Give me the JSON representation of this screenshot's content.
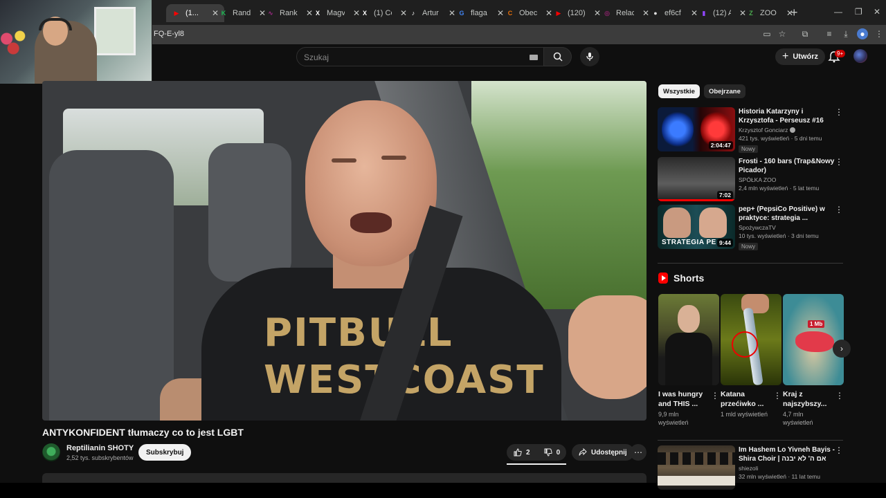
{
  "browser": {
    "tabs": [
      {
        "label": "(1...",
        "favicon": "youtube-icon",
        "color": "#ff0000",
        "active": true
      },
      {
        "label": "Rand",
        "favicon": "k-icon",
        "color": "#1db954"
      },
      {
        "label": "Ranki",
        "favicon": "rank-icon",
        "color": "#a52a8a"
      },
      {
        "label": "Magv",
        "favicon": "x-icon",
        "color": "#ffffff"
      },
      {
        "label": "(1) Co",
        "favicon": "x-icon",
        "color": "#ffffff"
      },
      {
        "label": "Artur",
        "favicon": "tiktok-icon",
        "color": "#ffffff"
      },
      {
        "label": "flaga",
        "favicon": "google-icon",
        "color": "#4285f4"
      },
      {
        "label": "Obec",
        "favicon": "c-icon",
        "color": "#e8700a"
      },
      {
        "label": "(120)",
        "favicon": "youtube-icon",
        "color": "#ff0000"
      },
      {
        "label": "Relac",
        "favicon": "instagram-icon",
        "color": "#d6249f"
      },
      {
        "label": "ef6cf",
        "favicon": "github-icon",
        "color": "#dddddd"
      },
      {
        "label": "(12) A",
        "favicon": "twitch-icon",
        "color": "#9146ff"
      },
      {
        "label": "ZOO",
        "favicon": "zoo-icon",
        "color": "#4caf50"
      }
    ],
    "url": "FQ-E-yl8",
    "new_tab_symbol": "+"
  },
  "header": {
    "search_placeholder": "Szukaj",
    "create_label": "Utwórz",
    "notif_count": "9+"
  },
  "video": {
    "shirt_line1": "PITBULL",
    "shirt_line2": "WESTCOAST",
    "title": "ANTYKONFIDENT tłumaczy co to jest LGBT",
    "channel": "Reptilianin SHOTY",
    "subscribers": "2,52 tys. subskrybentów",
    "subscribe_label": "Subskrybuj",
    "likes": "2",
    "dislikes": "0",
    "share_label": "Udostępnij"
  },
  "sidebar": {
    "chips": [
      "Wszystkie",
      "Obejrzane"
    ],
    "recommendations": [
      {
        "title": "Historia Katarzyny i Krzysztofa - Perseusz #16",
        "channel": "Krzysztof Gonciarz",
        "verified": true,
        "views": "421 tys. wyświetleń · 5 dni temu",
        "duration": "2:04:47",
        "badge": "Nowy"
      },
      {
        "title": "Frosti - 160 bars (Trap&Nowy Picador)",
        "channel": "SPÓŁKA ZOO",
        "verified": false,
        "views": "2,4 mln wyświetleń · 5 lat temu",
        "duration": "7:02",
        "badge": ""
      },
      {
        "title": "pep+ (PepsiCo Positive) w praktyce: strategia ...",
        "channel": "SpożywczaTV",
        "verified": false,
        "views": "10 tys. wyświetleń · 3 dni temu",
        "duration": "9:44",
        "badge": "Nowy",
        "thumb_text": "STRATEGIA PE"
      }
    ],
    "shorts_title": "Shorts",
    "shorts": [
      {
        "title": "I was hungry and THIS ...",
        "views": "9,9 mln wyświetleń"
      },
      {
        "title": "Katana przećiwko ...",
        "views": "1 mld wyświetleń"
      },
      {
        "title": "Kraj z najszybszy...",
        "views": "4,7 mln wyświetleń",
        "thumb_text": "1 Mb"
      }
    ],
    "next_rec": {
      "title": "Im Hashem Lo Yivneh Bayis - Shira Choir | אם ה' לא יבנה בית",
      "channel": "shiezoli",
      "views": "32 mln wyświetleń · 11 lat temu"
    }
  },
  "colors": {
    "accent": "#ff0000",
    "bg": "#0f0f0f",
    "chip": "#272727"
  }
}
